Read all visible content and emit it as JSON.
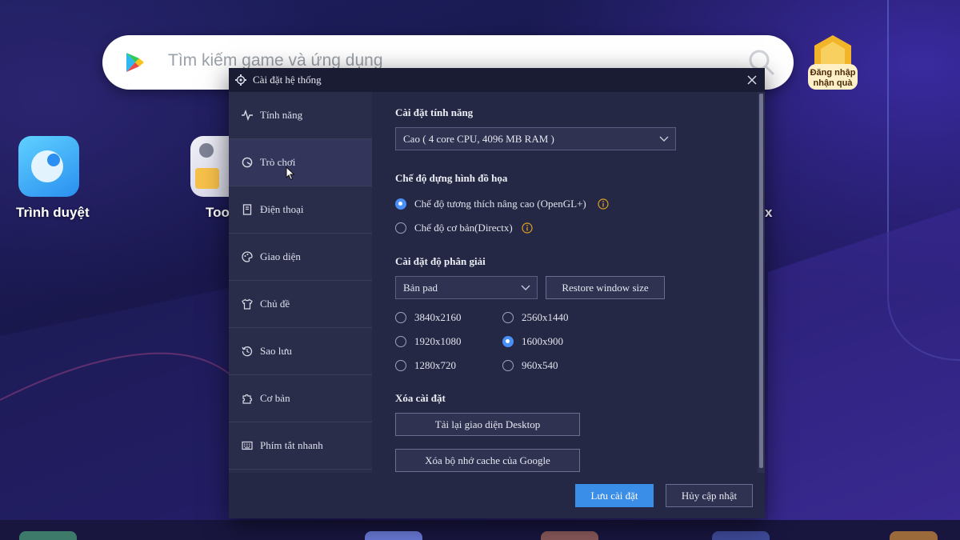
{
  "desktop": {
    "search_placeholder": "Tìm kiếm game và ứng dụng",
    "gift_label_line1": "Đăng nhập",
    "gift_label_line2": "nhận quà",
    "apps": [
      {
        "label": "Trình duyệt",
        "icon": "browser-icon"
      },
      {
        "label": "Tool",
        "icon": "tools-icon"
      }
    ],
    "partial_right_label": "x"
  },
  "dialog": {
    "title": "Cài đặt hệ thống",
    "sidebar": [
      {
        "label": "Tính năng",
        "icon": "performance-icon"
      },
      {
        "label": "Trò chơi",
        "icon": "game-icon"
      },
      {
        "label": "Điện thoại",
        "icon": "phone-icon"
      },
      {
        "label": "Giao diện",
        "icon": "palette-icon"
      },
      {
        "label": "Chủ đề",
        "icon": "shirt-icon"
      },
      {
        "label": "Sao lưu",
        "icon": "backup-icon"
      },
      {
        "label": "Cơ bản",
        "icon": "puzzle-icon"
      },
      {
        "label": "Phím tắt nhanh",
        "icon": "keyboard-icon"
      }
    ],
    "performance": {
      "title": "Cài đặt tính năng",
      "selected": "Cao ( 4 core CPU, 4096 MB RAM )"
    },
    "graphics": {
      "title": "Chế độ dựng hình đồ họa",
      "options": [
        {
          "label": "Chế độ tương thích nâng cao (OpenGL+)",
          "checked": true
        },
        {
          "label": "Chế độ cơ bản(Directx)",
          "checked": false
        }
      ]
    },
    "resolution": {
      "title": "Cài đặt độ phân giải",
      "selected": "Bản pad",
      "restore_label": "Restore window size",
      "options": [
        {
          "label": "3840x2160",
          "checked": false
        },
        {
          "label": "2560x1440",
          "checked": false
        },
        {
          "label": "1920x1080",
          "checked": false
        },
        {
          "label": "1600x900",
          "checked": true
        },
        {
          "label": "1280x720",
          "checked": false
        },
        {
          "label": "960x540",
          "checked": false
        }
      ]
    },
    "clear": {
      "title": "Xóa cài đặt",
      "reload_desktop": "Tải lại giao diện Desktop",
      "clear_google_cache": "Xóa bộ nhớ cache của Google"
    },
    "footer": {
      "save_label": "Lưu cài đặt",
      "cancel_label": "Hủy cập nhật"
    }
  },
  "colors": {
    "accent": "#3a8ee8",
    "dialog_bg": "#252844",
    "sidebar_bg": "#2a2d4a",
    "info": "#e0a020"
  }
}
